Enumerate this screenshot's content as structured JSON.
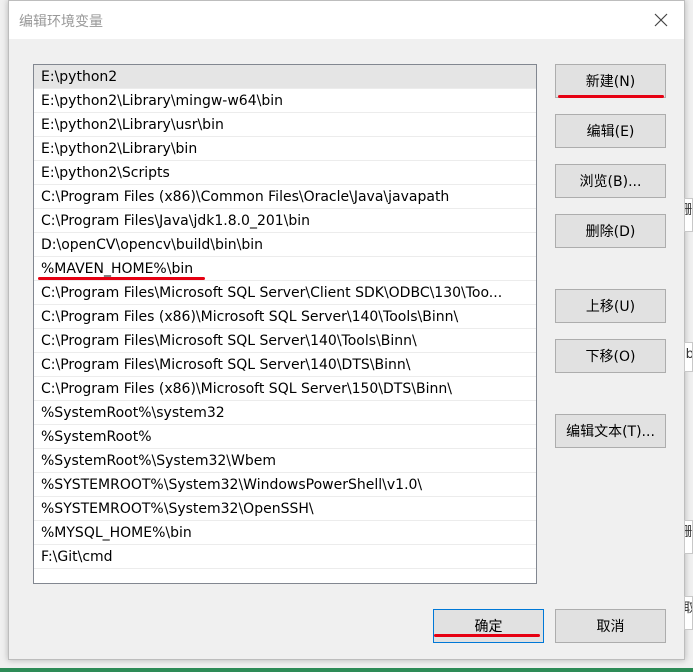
{
  "window": {
    "title": "编辑环境变量"
  },
  "paths": [
    "E:\\python2",
    "E:\\python2\\Library\\mingw-w64\\bin",
    "E:\\python2\\Library\\usr\\bin",
    "E:\\python2\\Library\\bin",
    "E:\\python2\\Scripts",
    "C:\\Program Files (x86)\\Common Files\\Oracle\\Java\\javapath",
    "C:\\Program Files\\Java\\jdk1.8.0_201\\bin",
    "D:\\openCV\\opencv\\build\\bin\\bin",
    "%MAVEN_HOME%\\bin",
    "C:\\Program Files\\Microsoft SQL Server\\Client SDK\\ODBC\\130\\Too...",
    "C:\\Program Files (x86)\\Microsoft SQL Server\\140\\Tools\\Binn\\",
    "C:\\Program Files\\Microsoft SQL Server\\140\\Tools\\Binn\\",
    "C:\\Program Files\\Microsoft SQL Server\\140\\DTS\\Binn\\",
    "C:\\Program Files (x86)\\Microsoft SQL Server\\150\\DTS\\Binn\\",
    "%SystemRoot%\\system32",
    "%SystemRoot%",
    "%SystemRoot%\\System32\\Wbem",
    "%SYSTEMROOT%\\System32\\WindowsPowerShell\\v1.0\\",
    "%SYSTEMROOT%\\System32\\OpenSSH\\",
    "%MYSQL_HOME%\\bin",
    "F:\\Git\\cmd"
  ],
  "selected_index": 0,
  "underlined_index": 8,
  "buttons": {
    "new": "新建(N)",
    "edit": "编辑(E)",
    "browse": "浏览(B)...",
    "delete": "删除(D)",
    "move_up": "上移(U)",
    "move_down": "下移(O)",
    "edit_text": "编辑文本(T)...",
    "ok": "确定",
    "cancel": "取消"
  },
  "background_fragments": [
    "删",
    "ib",
    "删",
    "取"
  ],
  "colors": {
    "highlight_red": "#e60012",
    "selection": "#e5e5e5",
    "default_button_border": "#0078d7"
  }
}
